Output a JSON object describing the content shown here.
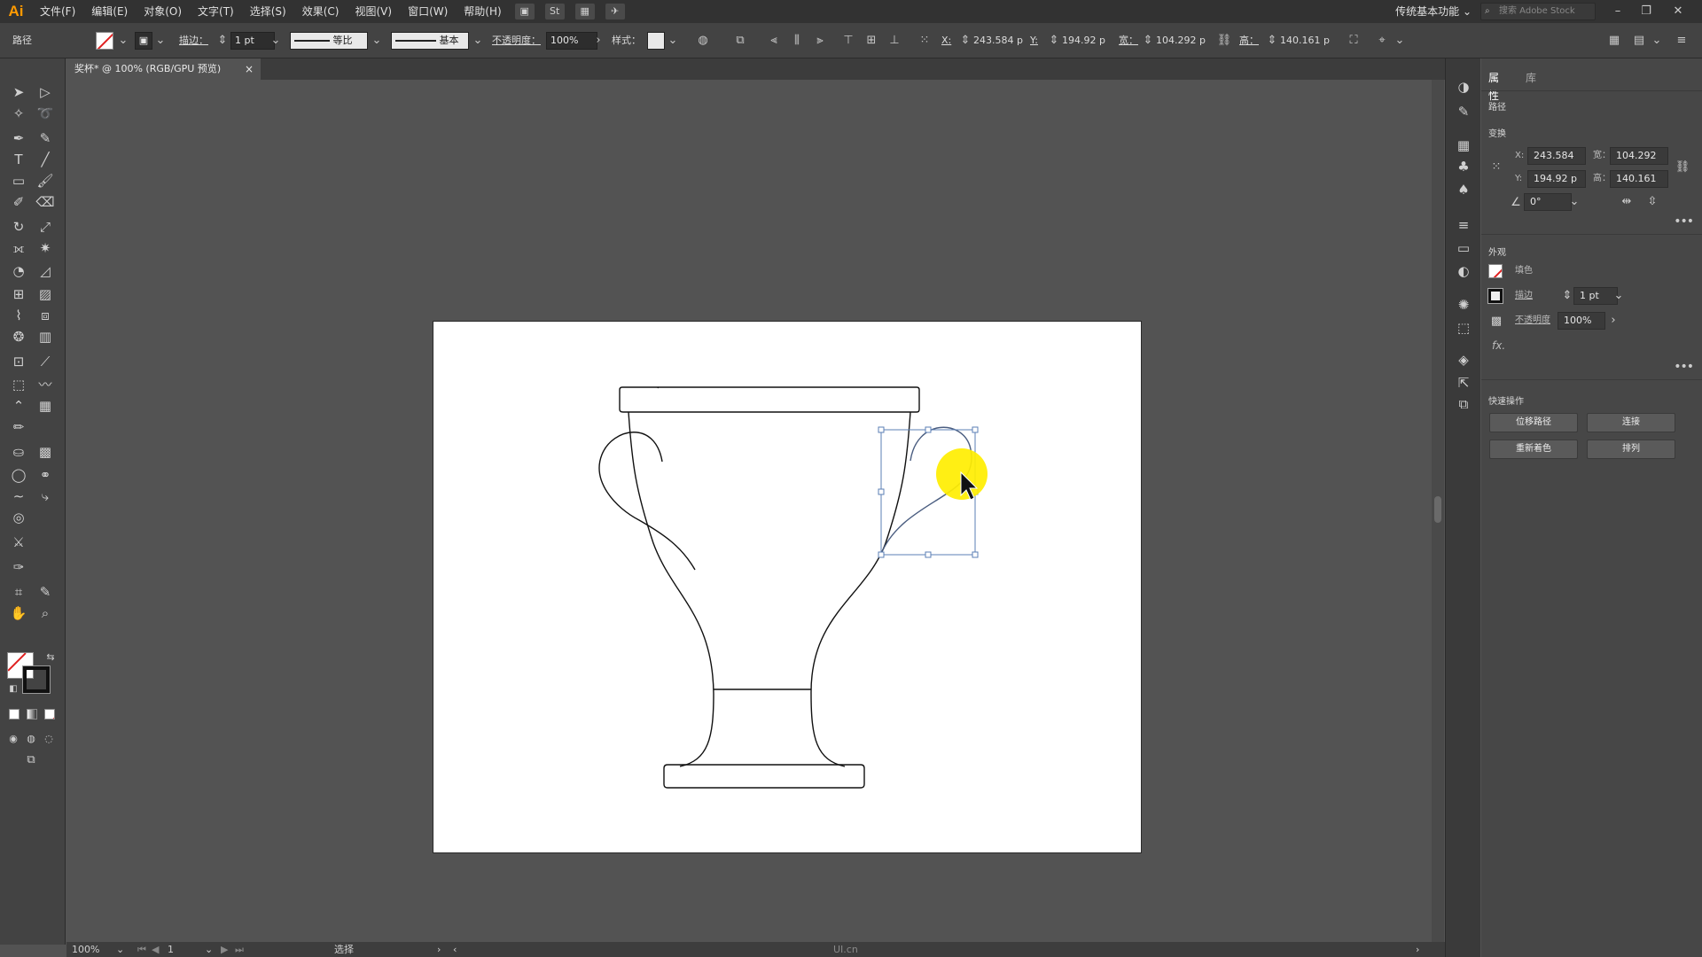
{
  "menubar": {
    "logo": "Ai",
    "items": [
      "文件(F)",
      "编辑(E)",
      "对象(O)",
      "文字(T)",
      "选择(S)",
      "效果(C)",
      "视图(V)",
      "窗口(W)",
      "帮助(H)"
    ],
    "st_label": "St",
    "workspace": "传统基本功能",
    "search_placeholder": "搜索 Adobe Stock"
  },
  "controlbar": {
    "object_type": "路径",
    "stroke_label": "描边：",
    "stroke_weight": "1 pt",
    "profile_label": "等比",
    "brush_label": "基本",
    "opacity_label": "不透明度：",
    "opacity_value": "100%",
    "style_label": "样式：",
    "x_label": "X:",
    "x_value": "243.584 p",
    "y_label": "Y:",
    "y_value": "194.92 p",
    "w_label": "宽：",
    "w_value": "104.292 p",
    "h_label": "高：",
    "h_value": "140.161 p"
  },
  "document": {
    "tab_title": "奖杯* @ 100% (RGB/GPU 预览)",
    "close_glyph": "×"
  },
  "statusbar": {
    "zoom": "100%",
    "artboard_number": "1",
    "tool_status": "选择",
    "watermark": "UI.cn"
  },
  "panel": {
    "tabs": [
      "属性",
      "库"
    ],
    "object_type": "路径",
    "transform_title": "变换",
    "x_label": "X:",
    "x_value": "243.584",
    "y_label": "Y:",
    "y_value": "194.92 p",
    "w_label": "宽：",
    "w_value": "104.292",
    "h_label": "高：",
    "h_value": "140.161",
    "angle_value": "0°",
    "appearance_title": "外观",
    "fill_label": "填色",
    "stroke_label": "描边",
    "stroke_value": "1 pt",
    "opacity_label": "不透明度",
    "opacity_value": "100%",
    "fx_label": "fx.",
    "quick_actions_title": "快速操作",
    "btn_offset_path": "位移路径",
    "btn_join": "连接",
    "btn_recolor": "重新着色",
    "btn_arrange": "排列"
  },
  "colors": {
    "ui_dark": "#323232",
    "ui_mid": "#434343",
    "canvas_bg": "#535353",
    "selection": "#4a6fa5",
    "cursor_highlight": "#ffee00",
    "logo": "#ff9a00"
  }
}
